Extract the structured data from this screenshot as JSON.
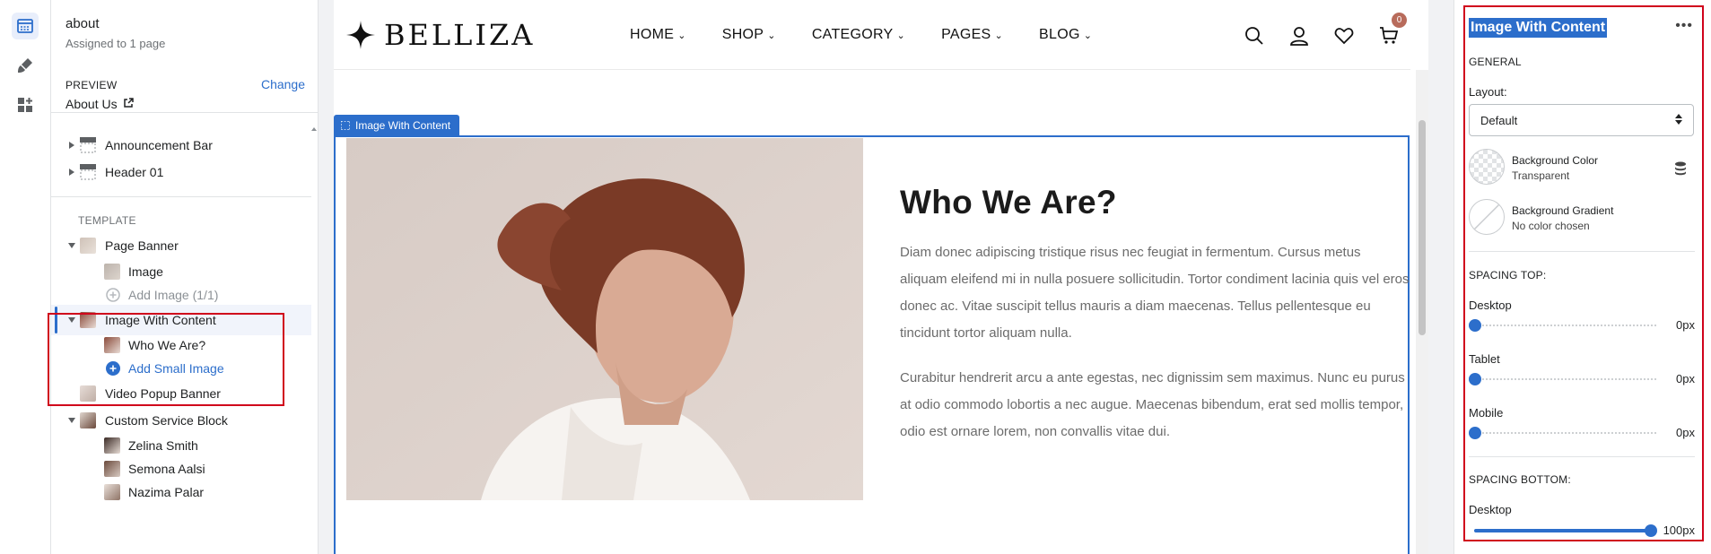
{
  "sidebar": {
    "page_title": "about",
    "assigned": "Assigned to 1 page",
    "preview_label": "PREVIEW",
    "preview_change": "Change",
    "preview_page": "About Us",
    "tree": {
      "announcement": "Announcement Bar",
      "header": "Header 01",
      "template_label": "TEMPLATE",
      "page_banner": "Page Banner",
      "image": "Image",
      "add_image": "Add Image (1/1)",
      "image_with_content": "Image With Content",
      "who_we_are": "Who We Are?",
      "add_small_image": "Add Small Image",
      "video_popup": "Video Popup Banner",
      "custom_service": "Custom Service Block",
      "people": [
        "Zelina Smith",
        "Semona Aalsi",
        "Nazima Palar"
      ]
    }
  },
  "preview": {
    "logo": "BELLIZA",
    "menu": [
      "HOME",
      "SHOP",
      "CATEGORY",
      "PAGES",
      "BLOG"
    ],
    "cart_count": "0",
    "section_tag": "Image With Content",
    "heading": "Who We Are?",
    "para1": "Diam donec adipiscing tristique risus nec feugiat in fermentum. Cursus metus aliquam eleifend mi in nulla posuere sollicitudin. Tortor condiment lacinia quis vel eros donec ac. Vitae suscipit tellus mauris a diam maecenas. Tellus pellentesque eu tincidunt tortor aliquam nulla.",
    "para2": "Curabitur hendrerit arcu a ante egestas, nec dignissim sem maximus. Nunc eu purus at odio commodo lobortis a nec augue. Maecenas bibendum, erat sed mollis tempor, odio est ornare lorem, non convallis vitae dui."
  },
  "settings": {
    "title": "Image With Content",
    "more": "•••",
    "general": "GENERAL",
    "layout_label": "Layout:",
    "layout_value": "Default",
    "bg_color_title": "Background Color",
    "bg_color_value": "Transparent",
    "bg_gradient_title": "Background Gradient",
    "bg_gradient_value": "No color chosen",
    "spacing_top": "SPACING TOP:",
    "desktop": "Desktop",
    "tablet": "Tablet",
    "mobile": "Mobile",
    "top_desktop": "0px",
    "top_tablet": "0px",
    "top_mobile": "0px",
    "spacing_bottom": "SPACING BOTTOM:",
    "bottom_desktop_label": "Desktop",
    "bottom_desktop": "100px",
    "bottom_desktop_level": 1.0
  },
  "colors": {
    "accent": "#2c6ecb",
    "highlight": "#d0021b",
    "badge": "#b86b5b"
  }
}
